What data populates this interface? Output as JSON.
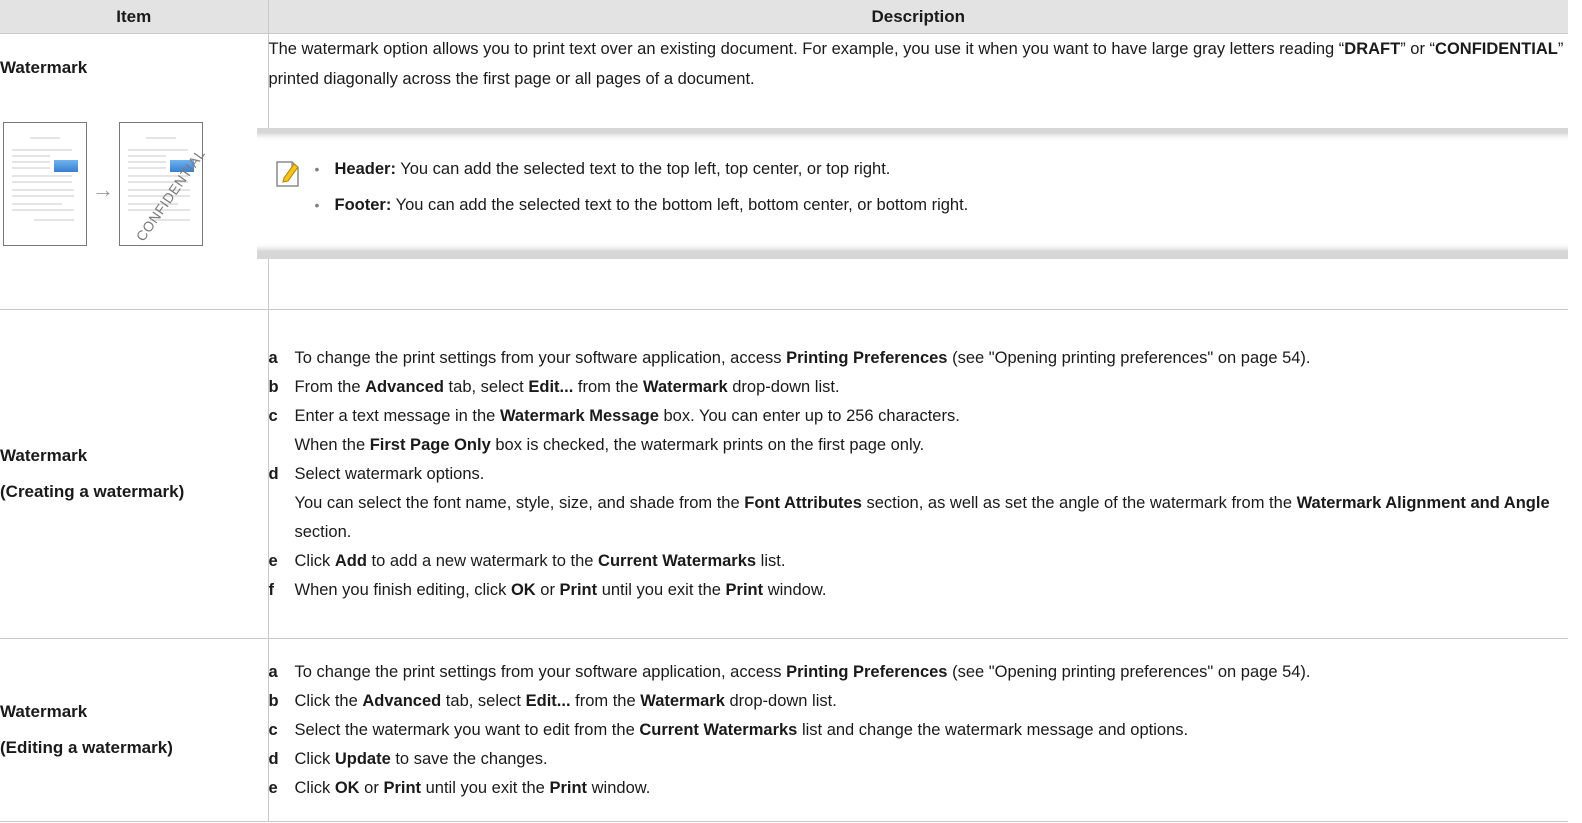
{
  "headers": {
    "item": "Item",
    "description": "Description"
  },
  "row1": {
    "item": "Watermark",
    "thumbnail_text": "CONFIDENTIAL",
    "intro": [
      {
        "t": "The watermark option allows you to print text over an existing document. For example, you use it when you want to have large gray letters reading “"
      },
      {
        "t": "DRAFT",
        "b": true
      },
      {
        "t": "” or “"
      },
      {
        "t": "CONFIDENTIAL",
        "b": true
      },
      {
        "t": "” printed diagonally across the first page or all pages of a document."
      }
    ],
    "note_icon": "note-pencil-icon",
    "note_items": [
      [
        {
          "t": "Header:",
          "b": true
        },
        {
          "t": " You can add the selected text to the top left, top center, or top right."
        }
      ],
      [
        {
          "t": "Footer:",
          "b": true
        },
        {
          "t": " You can add the selected text to the bottom left, bottom center, or bottom right."
        }
      ]
    ]
  },
  "row2": {
    "item": "Watermark",
    "item_sub": "(Creating a watermark)",
    "steps": [
      {
        "letter": "a",
        "runs": [
          {
            "t": "To change the print settings from your software application, access "
          },
          {
            "t": "Printing Preferences",
            "b": true
          },
          {
            "t": " (see \"Opening printing preferences\" on page 54)."
          }
        ]
      },
      {
        "letter": "b",
        "runs": [
          {
            "t": "From the "
          },
          {
            "t": "Advanced",
            "b": true
          },
          {
            "t": " tab, select "
          },
          {
            "t": "Edit...",
            "b": true
          },
          {
            "t": " from the "
          },
          {
            "t": "Watermark",
            "b": true
          },
          {
            "t": "  drop-down list."
          }
        ]
      },
      {
        "letter": "c",
        "runs": [
          {
            "t": "Enter a text message in the "
          },
          {
            "t": "Watermark Message",
            "b": true
          },
          {
            "t": " box. You can enter up to 256 characters."
          }
        ],
        "sub": [
          {
            "t": "When the "
          },
          {
            "t": "First Page Only",
            "b": true
          },
          {
            "t": " box is checked, the watermark prints on the first page only."
          }
        ]
      },
      {
        "letter": "d",
        "runs": [
          {
            "t": "Select watermark options."
          }
        ],
        "sub": [
          {
            "t": "You can select the font name, style, size, and shade from the "
          },
          {
            "t": "Font Attributes",
            "b": true
          },
          {
            "t": " section, as well as set the angle of the watermark from the "
          },
          {
            "t": "Watermark Alignment and Angle",
            "b": true
          },
          {
            "t": " section."
          }
        ]
      },
      {
        "letter": "e",
        "runs": [
          {
            "t": "Click "
          },
          {
            "t": "Add",
            "b": true
          },
          {
            "t": " to add a new watermark to the "
          },
          {
            "t": "Current Watermarks",
            "b": true
          },
          {
            "t": " list."
          }
        ]
      },
      {
        "letter": "f",
        "runs": [
          {
            "t": "When you finish editing, click "
          },
          {
            "t": "OK",
            "b": true
          },
          {
            "t": " or "
          },
          {
            "t": "Print",
            "b": true
          },
          {
            "t": " until you exit the "
          },
          {
            "t": "Print",
            "b": true
          },
          {
            "t": " window."
          }
        ]
      }
    ]
  },
  "row3": {
    "item": "Watermark",
    "item_sub": "(Editing a watermark)",
    "steps": [
      {
        "letter": "a",
        "runs": [
          {
            "t": "To change the print settings from your software application, access "
          },
          {
            "t": "Printing Preferences",
            "b": true
          },
          {
            "t": " (see \"Opening printing preferences\" on page 54)."
          }
        ]
      },
      {
        "letter": "b",
        "runs": [
          {
            "t": "Click the "
          },
          {
            "t": "Advanced",
            "b": true
          },
          {
            "t": " tab, select "
          },
          {
            "t": "Edit...",
            "b": true
          },
          {
            "t": " from the "
          },
          {
            "t": "Watermark",
            "b": true
          },
          {
            "t": "  drop-down list."
          }
        ]
      },
      {
        "letter": "c",
        "runs": [
          {
            "t": "Select the watermark you want to edit from the "
          },
          {
            "t": "Current Watermarks",
            "b": true
          },
          {
            "t": " list and change the watermark message and options."
          }
        ]
      },
      {
        "letter": "d",
        "runs": [
          {
            "t": "Click "
          },
          {
            "t": "Update",
            "b": true
          },
          {
            "t": " to save the changes."
          }
        ]
      },
      {
        "letter": "e",
        "runs": [
          {
            "t": "Click "
          },
          {
            "t": "OK",
            "b": true
          },
          {
            "t": " or "
          },
          {
            "t": "Print",
            "b": true
          },
          {
            "t": " until you exit the "
          },
          {
            "t": "Print",
            "b": true
          },
          {
            "t": " window."
          }
        ]
      }
    ]
  }
}
